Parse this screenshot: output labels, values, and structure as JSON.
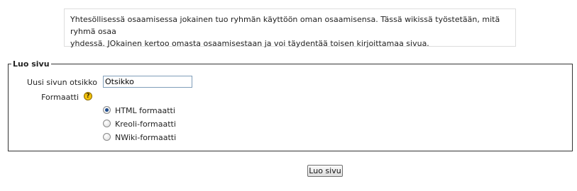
{
  "intro": {
    "line1": "Yhtesöllisessä osaamisessa jokainen tuo ryhmän käyttöön oman osaamisensa. Tässä wikissä työstetään, mitä ryhmä osaa",
    "line2": "yhdessä. JOkainen kertoo omasta osaamisestaan ja voi täydentää toisen kirjoittamaa sivua."
  },
  "form": {
    "legend": "Luo sivu",
    "title_label": "Uusi sivun otsikko",
    "title_value": "Otsikko",
    "format_label": "Formaatti",
    "help_icon": "help-icon",
    "formats": [
      {
        "label": "HTML formaatti",
        "checked": true
      },
      {
        "label": "Kreoli-formaatti",
        "checked": false
      },
      {
        "label": "NWiki-formaatti",
        "checked": false
      }
    ],
    "submit_label": "Luo sivu"
  }
}
